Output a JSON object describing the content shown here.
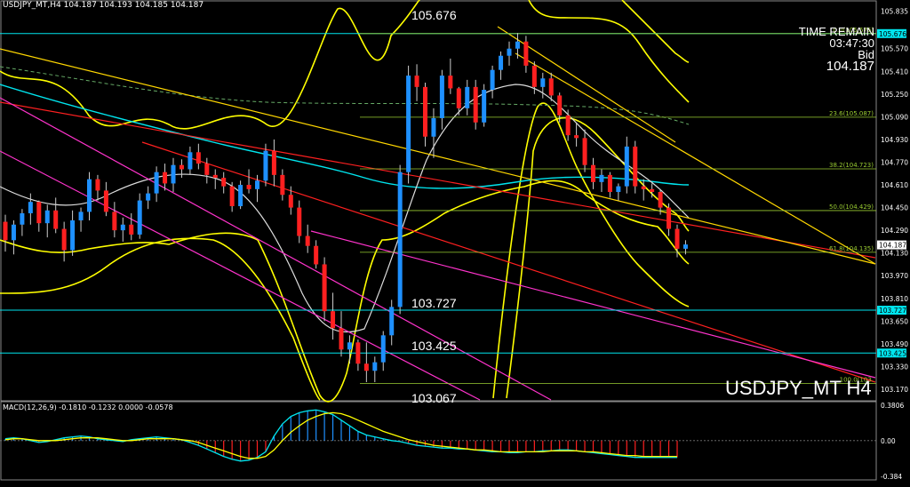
{
  "header": {
    "symbol_line": "USDJPY_MT,H4  104.187 104.193 104.185 104.187"
  },
  "macd_header": "MACD(12,26,9) -0.1810 -0.1232 0.0000 -0.0578",
  "overlay": {
    "time_remain_label": "TIME REMAIN",
    "time_remain": "03:47:30",
    "bid_label": "Bid",
    "bid": "104.187",
    "symbol": "USDJPY_MT H4"
  },
  "levels": {
    "high": "105.676",
    "mid1": "103.727",
    "mid2": "103.425",
    "low": "103.067"
  },
  "colors": {
    "bull": "#1e90ff",
    "bear": "#ff2020",
    "boll": "#ffff00",
    "ma_cyan": "#00e5ee",
    "fib": "#9acd32",
    "trend_red": "#ff2020",
    "trend_magenta": "#ff33cc",
    "trend_yellow": "#ffd700"
  },
  "chart_data": [
    {
      "type": "line",
      "title": "USDJPY_MT H4",
      "ylim": [
        103.17,
        105.8
      ],
      "y_ticks": [
        "105.835",
        "105.570",
        "105.410",
        "105.250",
        "105.090",
        "104.930",
        "104.770",
        "104.610",
        "104.450",
        "104.290",
        "104.130",
        "103.970",
        "103.810",
        "103.650",
        "103.490",
        "103.330",
        "103.170"
      ],
      "price_tags": [
        "105.676",
        "104.187",
        "103.727",
        "103.425"
      ],
      "horizontal_levels": [
        105.676,
        103.727,
        103.425
      ],
      "fibonacci": [
        {
          "label": "0.0(105.676)",
          "value": 105.676
        },
        {
          "label": "23.6(105.087)",
          "value": 105.087
        },
        {
          "label": "38.2(104.723)",
          "value": 104.723
        },
        {
          "label": "50.0(104.429)",
          "value": 104.429
        },
        {
          "label": "61.8(104.135)",
          "value": 104.135
        },
        {
          "label": "100.0(103.",
          "value": 103.21
        }
      ],
      "annotations": [
        "105.676",
        "103.727",
        "103.425",
        "103.067"
      ],
      "series": [
        {
          "type": "candlestick",
          "ohlc": [
            [
              104.35,
              104.4,
              104.14,
              104.22
            ],
            [
              104.22,
              104.36,
              104.12,
              104.33
            ],
            [
              104.33,
              104.44,
              104.25,
              104.41
            ],
            [
              104.41,
              104.55,
              104.33,
              104.49
            ],
            [
              104.49,
              104.5,
              104.28,
              104.34
            ],
            [
              104.34,
              104.47,
              104.24,
              104.43
            ],
            [
              104.43,
              104.52,
              104.27,
              104.3
            ],
            [
              104.3,
              104.35,
              104.07,
              104.15
            ],
            [
              104.15,
              104.43,
              104.11,
              104.36
            ],
            [
              104.36,
              104.45,
              104.28,
              104.42
            ],
            [
              104.42,
              104.7,
              104.36,
              104.65
            ],
            [
              104.65,
              104.68,
              104.5,
              104.57
            ],
            [
              104.57,
              104.63,
              104.39,
              104.42
            ],
            [
              104.42,
              104.49,
              104.24,
              104.29
            ],
            [
              104.29,
              104.38,
              104.21,
              104.33
            ],
            [
              104.33,
              104.41,
              104.22,
              104.26
            ],
            [
              104.26,
              104.55,
              104.23,
              104.5
            ],
            [
              104.5,
              104.6,
              104.44,
              104.55
            ],
            [
              104.55,
              104.74,
              104.49,
              104.7
            ],
            [
              104.7,
              104.76,
              104.57,
              104.62
            ],
            [
              104.62,
              104.8,
              104.56,
              104.75
            ],
            [
              104.75,
              104.79,
              104.66,
              104.72
            ],
            [
              104.72,
              104.88,
              104.68,
              104.84
            ],
            [
              104.84,
              104.9,
              104.72,
              104.76
            ],
            [
              104.76,
              104.8,
              104.62,
              104.68
            ],
            [
              104.68,
              104.72,
              104.58,
              104.66
            ],
            [
              104.66,
              104.7,
              104.55,
              104.6
            ],
            [
              104.6,
              104.63,
              104.42,
              104.46
            ],
            [
              104.46,
              104.64,
              104.44,
              104.61
            ],
            [
              104.61,
              104.72,
              104.55,
              104.58
            ],
            [
              104.58,
              104.68,
              104.49,
              104.64
            ],
            [
              104.64,
              104.9,
              104.6,
              104.85
            ],
            [
              104.85,
              104.93,
              104.6,
              104.68
            ],
            [
              104.68,
              104.72,
              104.5,
              104.54
            ],
            [
              104.54,
              104.6,
              104.4,
              104.45
            ],
            [
              104.45,
              104.5,
              104.2,
              104.25
            ],
            [
              104.25,
              104.33,
              104.13,
              104.18
            ],
            [
              104.18,
              104.22,
              104.02,
              104.05
            ],
            [
              104.05,
              104.1,
              103.65,
              103.72
            ],
            [
              103.72,
              103.85,
              103.52,
              103.6
            ],
            [
              103.6,
              103.72,
              103.4,
              103.45
            ],
            [
              103.45,
              103.55,
              103.35,
              103.5
            ],
            [
              103.5,
              103.52,
              103.3,
              103.35
            ],
            [
              103.35,
              103.5,
              103.22,
              103.3
            ],
            [
              103.3,
              103.4,
              103.22,
              103.36
            ],
            [
              103.36,
              103.58,
              103.3,
              103.55
            ],
            [
              103.55,
              103.8,
              103.48,
              103.75
            ],
            [
              103.75,
              104.75,
              103.7,
              104.7
            ],
            [
              104.7,
              105.45,
              104.62,
              105.38
            ],
            [
              105.38,
              105.46,
              105.2,
              105.3
            ],
            [
              105.3,
              105.33,
              104.88,
              104.95
            ],
            [
              104.95,
              105.15,
              104.8,
              105.08
            ],
            [
              105.08,
              105.42,
              105.0,
              105.38
            ],
            [
              105.38,
              105.5,
              105.25,
              105.29
            ],
            [
              105.29,
              105.3,
              105.1,
              105.15
            ],
            [
              105.15,
              105.35,
              105.1,
              105.3
            ],
            [
              105.3,
              105.35,
              105.0,
              105.05
            ],
            [
              105.05,
              105.32,
              105.02,
              105.28
            ],
            [
              105.28,
              105.45,
              105.22,
              105.42
            ],
            [
              105.42,
              105.55,
              105.35,
              105.52
            ],
            [
              105.52,
              105.62,
              105.45,
              105.57
            ],
            [
              105.57,
              105.68,
              105.5,
              105.62
            ],
            [
              105.62,
              105.66,
              105.4,
              105.45
            ],
            [
              105.45,
              105.48,
              105.25,
              105.3
            ],
            [
              105.3,
              105.4,
              105.22,
              105.36
            ],
            [
              105.36,
              105.4,
              105.2,
              105.24
            ],
            [
              105.24,
              105.26,
              105.05,
              105.1
            ],
            [
              105.1,
              105.14,
              104.92,
              104.96
            ],
            [
              104.96,
              105.05,
              104.88,
              104.94
            ],
            [
              104.94,
              105.0,
              104.7,
              104.75
            ],
            [
              104.75,
              104.8,
              104.58,
              104.63
            ],
            [
              104.63,
              104.72,
              104.56,
              104.68
            ],
            [
              104.68,
              104.7,
              104.52,
              104.56
            ],
            [
              104.56,
              104.62,
              104.5,
              104.6
            ],
            [
              104.6,
              104.95,
              104.55,
              104.88
            ],
            [
              104.88,
              104.92,
              104.55,
              104.6
            ],
            [
              104.6,
              104.65,
              104.5,
              104.58
            ],
            [
              104.58,
              104.62,
              104.52,
              104.56
            ],
            [
              104.56,
              104.58,
              104.4,
              104.45
            ],
            [
              104.45,
              104.48,
              104.25,
              104.3
            ],
            [
              104.3,
              104.33,
              104.1,
              104.16
            ],
            [
              104.16,
              104.22,
              104.12,
              104.19
            ]
          ]
        }
      ]
    },
    {
      "type": "line",
      "title": "MACD(12,26,9)",
      "ylim": [
        -0.384,
        0.3806
      ],
      "y_ticks": [
        "0.3806",
        "0.00",
        "-0.384"
      ],
      "series": [
        {
          "name": "MACD",
          "type": "histogram",
          "values": [
            0.02,
            0.03,
            0.02,
            0.0,
            -0.02,
            -0.01,
            0.01,
            0.03,
            0.04,
            0.05,
            0.04,
            0.02,
            0.01,
            0.0,
            -0.01,
            0.01,
            0.02,
            0.03,
            0.04,
            0.03,
            0.02,
            0.01,
            -0.02,
            -0.05,
            -0.09,
            -0.13,
            -0.17,
            -0.2,
            -0.22,
            -0.21,
            -0.18,
            -0.12,
            0.05,
            0.18,
            0.26,
            0.3,
            0.32,
            0.33,
            0.31,
            0.28,
            0.22,
            0.16,
            0.1,
            0.06,
            0.04,
            0.02,
            0.0,
            -0.01,
            -0.03,
            -0.05,
            -0.06,
            -0.07,
            -0.08,
            -0.08,
            -0.09,
            -0.09,
            -0.1,
            -0.11,
            -0.12,
            -0.12,
            -0.13,
            -0.13,
            -0.12,
            -0.12,
            -0.11,
            -0.11,
            -0.1,
            -0.1,
            -0.11,
            -0.12,
            -0.13,
            -0.14,
            -0.15,
            -0.16,
            -0.17,
            -0.18,
            -0.18,
            -0.18,
            -0.18,
            -0.18,
            -0.18
          ]
        },
        {
          "name": "Signal",
          "type": "line",
          "values": [
            0.01,
            0.02,
            0.02,
            0.01,
            0.0,
            0.0,
            0.0,
            0.01,
            0.02,
            0.03,
            0.03,
            0.03,
            0.02,
            0.01,
            0.0,
            0.0,
            0.01,
            0.02,
            0.02,
            0.02,
            0.02,
            0.01,
            0.0,
            -0.02,
            -0.05,
            -0.08,
            -0.11,
            -0.14,
            -0.17,
            -0.19,
            -0.19,
            -0.17,
            -0.1,
            0.0,
            0.09,
            0.16,
            0.22,
            0.26,
            0.29,
            0.3,
            0.29,
            0.26,
            0.22,
            0.18,
            0.14,
            0.1,
            0.07,
            0.04,
            0.01,
            -0.01,
            -0.03,
            -0.05,
            -0.06,
            -0.07,
            -0.08,
            -0.09,
            -0.1,
            -0.1,
            -0.11,
            -0.12,
            -0.12,
            -0.12,
            -0.12,
            -0.12,
            -0.12,
            -0.11,
            -0.11,
            -0.11,
            -0.11,
            -0.12,
            -0.12,
            -0.13,
            -0.14,
            -0.15,
            -0.16,
            -0.16,
            -0.17,
            -0.17,
            -0.17,
            -0.17,
            -0.17
          ]
        }
      ]
    }
  ]
}
